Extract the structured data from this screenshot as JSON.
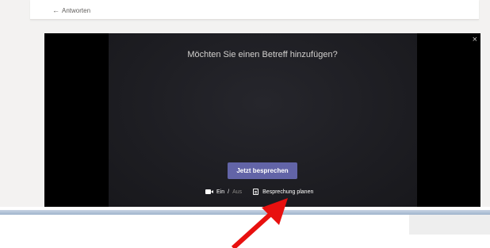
{
  "thread": {
    "reply_label": "Antworten"
  },
  "video_dialog": {
    "prompt": "Möchten Sie einen Betreff hinzufügen?",
    "meet_now_label": "Jetzt besprechen",
    "close_glyph": "×",
    "camera": {
      "on_label": "Ein",
      "separator": "/",
      "off_label": "Aus",
      "state": "on"
    },
    "schedule_label": "Besprechung planen"
  },
  "icons": [
    "reply-arrow-icon",
    "close-icon",
    "camera-icon",
    "calendar-icon"
  ],
  "colors": {
    "accent": "#6264a7",
    "annotation_arrow": "#e8100f"
  }
}
